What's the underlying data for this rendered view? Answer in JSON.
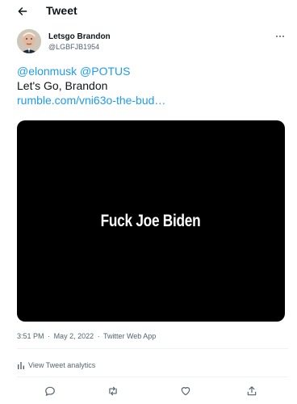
{
  "header": {
    "title": "Tweet"
  },
  "author": {
    "display_name": "Letsgo Brandon",
    "handle": "@LGBFJB1954"
  },
  "tweet": {
    "mentions": [
      "@elonmusk",
      "@POTUS"
    ],
    "text": "Let's Go, Brandon",
    "link": "rumble.com/vni63o-the-bud…"
  },
  "media": {
    "overlay_text": "Fuck Joe Biden"
  },
  "meta": {
    "time": "3:51 PM",
    "separator": "·",
    "date": "May 2, 2022",
    "source": "Twitter Web App"
  },
  "analytics": {
    "label": "View Tweet analytics"
  },
  "icons": {
    "back": "arrow-left-icon",
    "more": "more-horizontal-icon",
    "analytics": "bar-chart-icon",
    "reply": "reply-icon",
    "retweet": "retweet-icon",
    "like": "heart-icon",
    "share": "share-icon"
  },
  "colors": {
    "link": "#1d9bf0",
    "secondary_text": "#536471",
    "media_bg": "#000000"
  }
}
